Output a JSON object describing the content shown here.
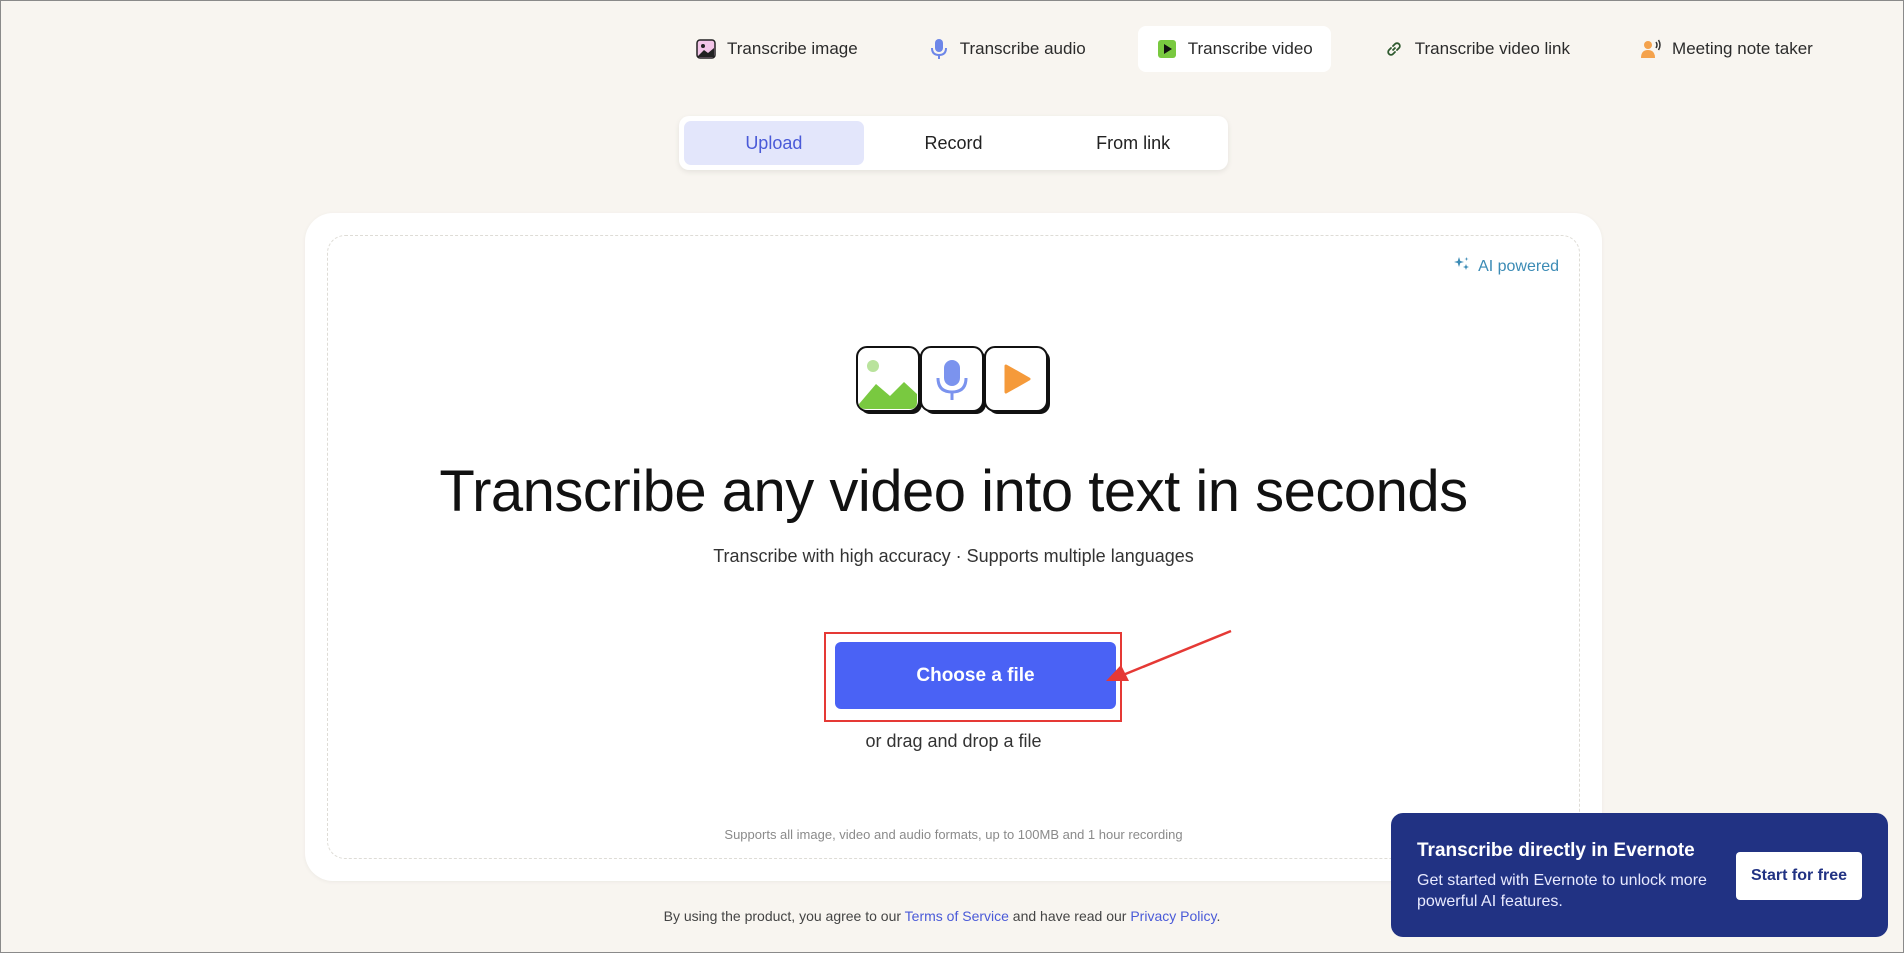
{
  "nav": {
    "items": [
      {
        "label": "Transcribe image",
        "icon": "image-icon"
      },
      {
        "label": "Transcribe audio",
        "icon": "microphone-icon"
      },
      {
        "label": "Transcribe video",
        "icon": "video-play-icon",
        "active": true
      },
      {
        "label": "Transcribe video link",
        "icon": "link-icon"
      },
      {
        "label": "Meeting note taker",
        "icon": "speaker-person-icon"
      }
    ]
  },
  "tabs": [
    {
      "label": "Upload",
      "active": true
    },
    {
      "label": "Record"
    },
    {
      "label": "From link"
    }
  ],
  "card": {
    "ai_badge": "AI powered",
    "headline": "Transcribe any video into text in seconds",
    "subline": "Transcribe with high accuracy · Supports multiple languages",
    "choose_button": "Choose a file",
    "drag_text": "or drag and drop a file",
    "formats": "Supports all image, video and audio formats, up to 100MB and 1 hour recording"
  },
  "footer": {
    "prefix": "By using the product, you agree to our ",
    "terms": "Terms of Service",
    "middle": " and have read our ",
    "privacy": "Privacy Policy",
    "suffix": "."
  },
  "promo": {
    "title": "Transcribe directly in Evernote",
    "text": "Get started with Evernote to unlock more powerful AI features.",
    "button": "Start for free"
  },
  "colors": {
    "background": "#f8f5f0",
    "accent": "#4a62f5",
    "promo_bg": "#213283",
    "highlight": "#e53935"
  }
}
